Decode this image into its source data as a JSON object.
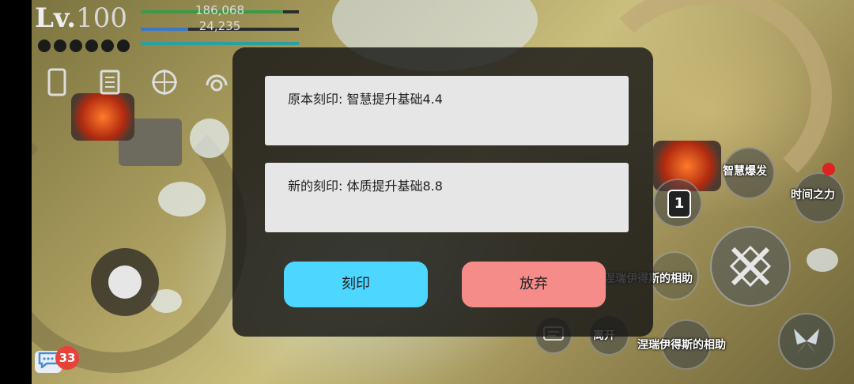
{
  "hud": {
    "level_prefix": "Lv.",
    "level": "100",
    "hp": "186,068",
    "hp_fraction": 0.9,
    "mp": "24,235",
    "mp_fraction": 0.3,
    "xp_fraction": 1.0,
    "colors": {
      "hp": "#3a9a4a",
      "mp": "#3a78c8",
      "xp": "#2aa0a0"
    }
  },
  "top_menu_icons": [
    "phone-icon",
    "quest-scroll-icon",
    "target-icon",
    "headset-icon"
  ],
  "skills": {
    "wisdom_burst": "智慧爆发",
    "time_power": "时间之力",
    "slot_number": "1",
    "blessing_top": "涅瑞伊得斯的相助",
    "leave": "离开",
    "blessing_bottom": "涅瑞伊得斯的相助"
  },
  "chat": {
    "badge_count": "33"
  },
  "modal": {
    "old_rune": "原本刻印: 智慧提升基础4.4",
    "new_rune": "新的刻印: 体质提升基础8.8",
    "confirm_label": "刻印",
    "cancel_label": "放弃"
  }
}
